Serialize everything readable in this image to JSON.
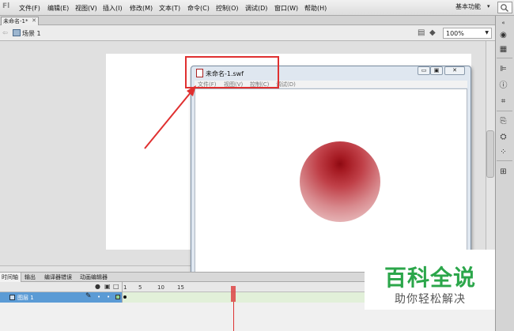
{
  "app": {
    "logo_text": "Fl"
  },
  "menus": [
    "文件(F)",
    "编辑(E)",
    "视图(V)",
    "插入(I)",
    "修改(M)",
    "文本(T)",
    "命令(C)",
    "控制(O)",
    "调试(D)",
    "窗口(W)",
    "帮助(H)"
  ],
  "workspace": {
    "label": "基本功能",
    "arrow": "▾"
  },
  "document_tab": {
    "label": "未命名-1*",
    "close": "✕"
  },
  "scene": {
    "back": "⇦",
    "label": "场景 1",
    "zoom": "100%"
  },
  "swf_window": {
    "title": "未命名-1.swf",
    "menus": [
      "文件(F)",
      "视图(V)",
      "控制(C)",
      "调试(D)"
    ],
    "min": "▭",
    "max": "▣",
    "close": "✕"
  },
  "timeline": {
    "tabs": [
      "时间轴",
      "输出",
      "编译器错误",
      "动画编辑器"
    ],
    "ruler": [
      "1",
      "5",
      "10",
      "15"
    ],
    "layer_name": "图层 1"
  },
  "watermark": {
    "title": "百科全说",
    "subtitle": "助你轻松解决"
  },
  "colors": {
    "highlight": "#e03030",
    "ball_center": "#8e0a12",
    "watermark_green": "#2ba64a",
    "layer_selected": "#5b9bd5"
  }
}
